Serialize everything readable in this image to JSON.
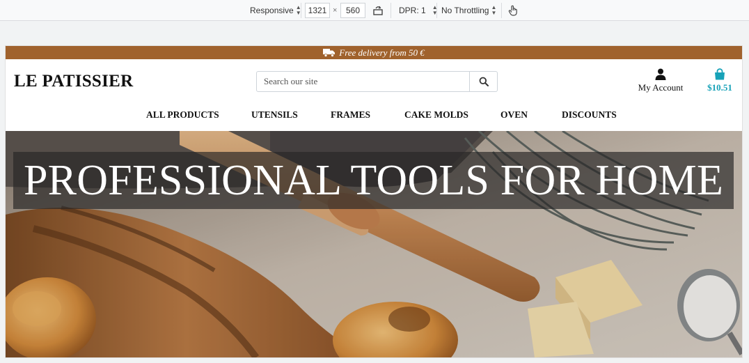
{
  "devtools": {
    "device": "Responsive",
    "width": "1321",
    "height": "560",
    "dpr": "DPR: 1",
    "throttling": "No Throttling"
  },
  "promo": {
    "text": "Free delivery from 50 €"
  },
  "header": {
    "logo": "LE PATISSIER",
    "search_placeholder": "Search our site",
    "account_label": "My Account",
    "cart_total": "$10.51"
  },
  "nav": [
    "ALL PRODUCTS",
    "UTENSILS",
    "FRAMES",
    "CAKE MOLDS",
    "OVEN",
    "DISCOUNTS"
  ],
  "hero": {
    "title": "PROFESSIONAL TOOLS FOR HOME"
  },
  "colors": {
    "promo_bg": "#a0622d",
    "cart_accent": "#17a2b8"
  },
  "icons": [
    "truck-icon",
    "search-icon",
    "user-icon",
    "shopping-bag-icon",
    "rotate-icon",
    "touch-icon"
  ]
}
